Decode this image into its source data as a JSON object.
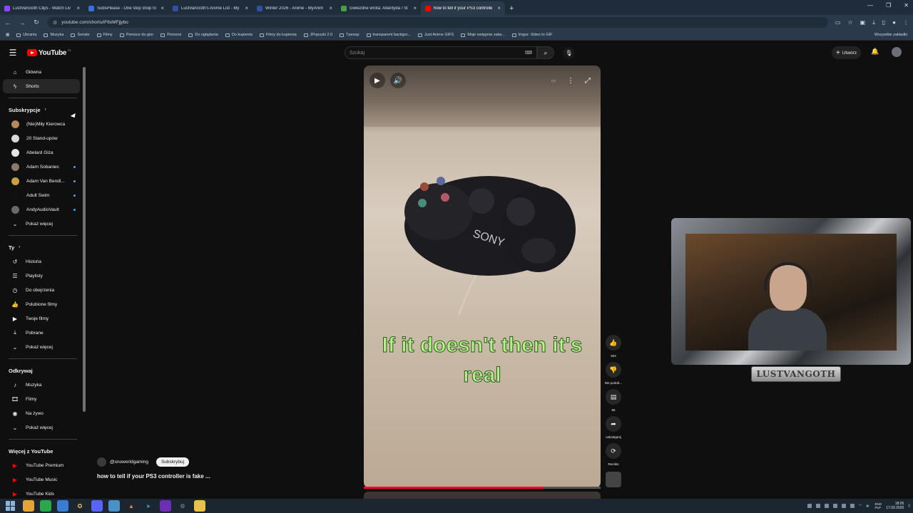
{
  "browser": {
    "tabs": [
      {
        "title": "LustVanGoth Clips - Watch Liv",
        "color": "#9146ff",
        "active": false
      },
      {
        "title": "SubsPlease - One stop shop fo",
        "color": "#3a6fd8",
        "active": false
      },
      {
        "title": "LustVanGoth's Anime List - My",
        "color": "#2e51a2",
        "active": false
      },
      {
        "title": "Winter 2026 - Anime - MyAnim",
        "color": "#2e51a2",
        "active": false
      },
      {
        "title": "Gwiezdne wrota: Atlantyda / St",
        "color": "#4a9d4a",
        "active": false
      },
      {
        "title": "how to tell if your PS3 controlle",
        "color": "#ff0000",
        "active": true
      }
    ],
    "new_tab": "+",
    "url": "youtube.com/shorts/iF6xMFjjybo",
    "bookmarks": [
      "Ubrania",
      "Muzyka",
      "Seriale",
      "Filmy",
      "Pomoce do gier",
      "Pomoce",
      "Do oglądania",
      "Do kupienia",
      "Filmy do kupienia",
      "JPopuski 2.0",
      "Tpexap",
      "transparent backgro...",
      "Just Anime GIFS",
      "Moje wstępnie zatw...",
      "Imgur: Video to GIF"
    ],
    "all_bookmarks": "Wszystkie zakładki"
  },
  "masthead": {
    "logo_text": "YouTube",
    "country_code": "PL",
    "search_placeholder": "Szukaj",
    "create_label": "Utwórz"
  },
  "sidebar": {
    "main": [
      {
        "label": "Główna",
        "icon": "⌂",
        "active": false
      },
      {
        "label": "Shorts",
        "icon": "ϟ",
        "active": true
      }
    ],
    "subs_header": "Subskrypcje",
    "subs": [
      {
        "label": "(Nie)Miły Kierowca",
        "color": "#b38a5a",
        "dot": false
      },
      {
        "label": "20 Stand-upów",
        "color": "#d9d9d9",
        "dot": false
      },
      {
        "label": "Abelard Giza",
        "color": "#e6e6e6",
        "dot": false
      },
      {
        "label": "Adam Sobaniec",
        "color": "#8a7a6a",
        "dot": true
      },
      {
        "label": "Adam Van Bendl...",
        "color": "#c8a040",
        "dot": true
      },
      {
        "label": "Adult Swim",
        "color": "#111111",
        "dot": true
      },
      {
        "label": "AndyAudioVault",
        "color": "#6a6a6a",
        "dot": true
      }
    ],
    "more_label": "Pokaż więcej",
    "you_header": "Ty",
    "you": [
      {
        "label": "Historia",
        "icon": "↺"
      },
      {
        "label": "Playlisty",
        "icon": "☰"
      },
      {
        "label": "Do obejrzenia",
        "icon": "◷"
      },
      {
        "label": "Polubione filmy",
        "icon": "👍"
      },
      {
        "label": "Twoje filmy",
        "icon": "▶"
      },
      {
        "label": "Pobrane",
        "icon": "⤓"
      }
    ],
    "explore_header": "Odkrywaj",
    "explore": [
      {
        "label": "Muzyka",
        "icon": "♪"
      },
      {
        "label": "Filmy",
        "icon": "🎞"
      },
      {
        "label": "Na żywo",
        "icon": "◉"
      }
    ],
    "more_yt_header": "Więcej z YouTube",
    "more_yt": [
      {
        "label": "YouTube Premium"
      },
      {
        "label": "YouTube Music"
      },
      {
        "label": "YouTube Kids"
      }
    ]
  },
  "player": {
    "caption": "If it doesn't then it's real",
    "progress": 0.76
  },
  "actions": {
    "like_count": "924",
    "dislike_label": "Nie podob...",
    "comment_count": "65",
    "share_label": "Udostępnij",
    "remix_label": "Remiks"
  },
  "video": {
    "channel": "@snoworldgaming",
    "subscribe_label": "Subskrybuj",
    "title": "how to tell if your PS3 controller is fake ..."
  },
  "webcam": {
    "nameplate": "LUSTVANGOTH"
  },
  "taskbar": {
    "lang_top": "ENG",
    "lang_bottom": "PLP",
    "time": "18:05",
    "date": "17.03.2026"
  }
}
